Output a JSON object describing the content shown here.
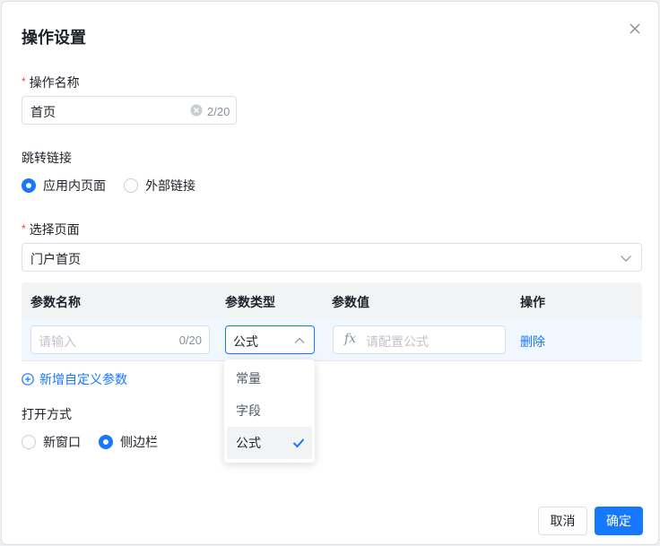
{
  "dialog": {
    "title": "操作设置",
    "confirm_label": "确定",
    "cancel_label": "取消"
  },
  "action_name": {
    "label": "操作名称",
    "required_mark": "*",
    "value": "首页",
    "counter": "2/20"
  },
  "jump_link": {
    "label": "跳转链接",
    "options": [
      "应用内页面",
      "外部链接"
    ],
    "selected": "应用内页面"
  },
  "page_select": {
    "label": "选择页面",
    "required_mark": "*",
    "value": "门户首页"
  },
  "params_table": {
    "headers": [
      "参数名称",
      "参数类型",
      "参数值",
      "操作"
    ],
    "row": {
      "name_placeholder": "请输入",
      "name_counter": "0/20",
      "type_value": "公式",
      "value_placeholder": "请配置公式",
      "fx_label": "fx",
      "delete_label": "删除"
    },
    "add_label": "新增自定义参数"
  },
  "type_dropdown": {
    "options": [
      "常量",
      "字段",
      "公式"
    ],
    "selected": "公式"
  },
  "open_mode": {
    "label": "打开方式",
    "options": [
      "新窗口",
      "侧边栏"
    ],
    "selected": "侧边栏"
  },
  "colors": {
    "accent": "#1677ff",
    "required": "#f53f3f",
    "row_highlight": "#f0f7ff"
  }
}
